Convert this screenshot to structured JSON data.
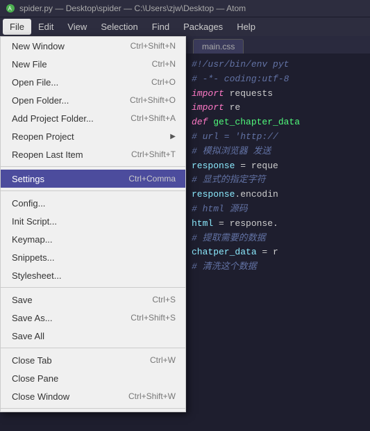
{
  "titleBar": {
    "title": "spider.py — Desktop\\spider — C:\\Users\\zjw\\Desktop — Atom"
  },
  "menuBar": {
    "items": [
      {
        "label": "File",
        "active": true
      },
      {
        "label": "Edit",
        "active": false
      },
      {
        "label": "View",
        "active": false
      },
      {
        "label": "Selection",
        "active": false
      },
      {
        "label": "Find",
        "active": false
      },
      {
        "label": "Packages",
        "active": false
      },
      {
        "label": "Help",
        "active": false
      }
    ]
  },
  "dropdown": {
    "items": [
      {
        "label": "New Window",
        "shortcut": "Ctrl+Shift+N",
        "type": "item"
      },
      {
        "label": "New File",
        "shortcut": "Ctrl+N",
        "type": "item"
      },
      {
        "label": "Open File...",
        "shortcut": "Ctrl+O",
        "type": "item"
      },
      {
        "label": "Open Folder...",
        "shortcut": "Ctrl+Shift+O",
        "type": "item"
      },
      {
        "label": "Add Project Folder...",
        "shortcut": "Ctrl+Shift+A",
        "type": "item"
      },
      {
        "label": "Reopen Project",
        "shortcut": "",
        "arrow": "▶",
        "type": "item"
      },
      {
        "label": "Reopen Last Item",
        "shortcut": "Ctrl+Shift+T",
        "type": "item"
      },
      {
        "type": "divider"
      },
      {
        "label": "Settings",
        "shortcut": "Ctrl+Comma",
        "type": "item",
        "highlighted": true
      },
      {
        "type": "divider"
      },
      {
        "label": "Config...",
        "shortcut": "",
        "type": "item"
      },
      {
        "label": "Init Script...",
        "shortcut": "",
        "type": "item"
      },
      {
        "label": "Keymap...",
        "shortcut": "",
        "type": "item"
      },
      {
        "label": "Snippets...",
        "shortcut": "",
        "type": "item"
      },
      {
        "label": "Stylesheet...",
        "shortcut": "",
        "type": "item"
      },
      {
        "type": "divider"
      },
      {
        "label": "Save",
        "shortcut": "Ctrl+S",
        "type": "item"
      },
      {
        "label": "Save As...",
        "shortcut": "Ctrl+Shift+S",
        "type": "item"
      },
      {
        "label": "Save All",
        "shortcut": "",
        "type": "item"
      },
      {
        "type": "divider"
      },
      {
        "label": "Close Tab",
        "shortcut": "Ctrl+W",
        "type": "item"
      },
      {
        "label": "Close Pane",
        "shortcut": "",
        "type": "item"
      },
      {
        "label": "Close Window",
        "shortcut": "Ctrl+Shift+W",
        "type": "item"
      },
      {
        "type": "divider"
      }
    ]
  },
  "codeTab": {
    "filename": "main.css"
  },
  "codeLines": [
    {
      "text": "#!/usr/bin/env pyt",
      "parts": [
        {
          "t": "cm",
          "v": "#!/usr/bin/env pyt"
        }
      ]
    },
    {
      "text": "# -*- coding:utf-8",
      "parts": [
        {
          "t": "cm",
          "v": "# -*- coding:utf-8"
        }
      ]
    },
    {
      "text": "import requests",
      "parts": [
        {
          "t": "kw",
          "v": "import"
        },
        {
          "t": "",
          "v": " requests"
        }
      ]
    },
    {
      "text": "import re",
      "parts": [
        {
          "t": "kw",
          "v": "import"
        },
        {
          "t": "",
          "v": " re"
        }
      ]
    },
    {
      "text": "def get_chapter_data",
      "parts": [
        {
          "t": "kw",
          "v": "def"
        },
        {
          "t": "",
          "v": " "
        },
        {
          "t": "fn",
          "v": "get_chapter_data"
        }
      ]
    },
    {
      "text": "    # url = 'http://",
      "parts": [
        {
          "t": "cm",
          "v": "    # url = 'http://"
        }
      ]
    },
    {
      "text": "    # 模拟浏览器 发送",
      "parts": [
        {
          "t": "cm",
          "v": "    # 模拟浏览器 发送"
        }
      ]
    },
    {
      "text": "    response = reque",
      "parts": [
        {
          "t": "",
          "v": "    "
        },
        {
          "t": "var",
          "v": "response"
        },
        {
          "t": "",
          "v": " = reque"
        }
      ]
    },
    {
      "text": "    # 显式的指定字符",
      "parts": [
        {
          "t": "cm",
          "v": "    # 显式的指定字符"
        }
      ]
    },
    {
      "text": "    response.encodin",
      "parts": [
        {
          "t": "",
          "v": "    "
        },
        {
          "t": "var",
          "v": "response"
        },
        {
          "t": "",
          "v": ".encodin"
        }
      ]
    },
    {
      "text": "    # html 源码",
      "parts": [
        {
          "t": "cm",
          "v": "    # html 源码"
        }
      ]
    },
    {
      "text": "    html = response.",
      "parts": [
        {
          "t": "",
          "v": "    "
        },
        {
          "t": "var",
          "v": "html"
        },
        {
          "t": "",
          "v": " = response."
        }
      ]
    },
    {
      "text": "    # 提取需要的数据",
      "parts": [
        {
          "t": "cm",
          "v": "    # 提取需要的数据"
        }
      ]
    },
    {
      "text": "    chatper_data = r",
      "parts": [
        {
          "t": "",
          "v": "    "
        },
        {
          "t": "var",
          "v": "chatper_data"
        },
        {
          "t": "",
          "v": " = r"
        }
      ]
    },
    {
      "text": "    # 清洗这个数据",
      "parts": [
        {
          "t": "cm",
          "v": "    # 清洗这个数据"
        }
      ]
    }
  ]
}
